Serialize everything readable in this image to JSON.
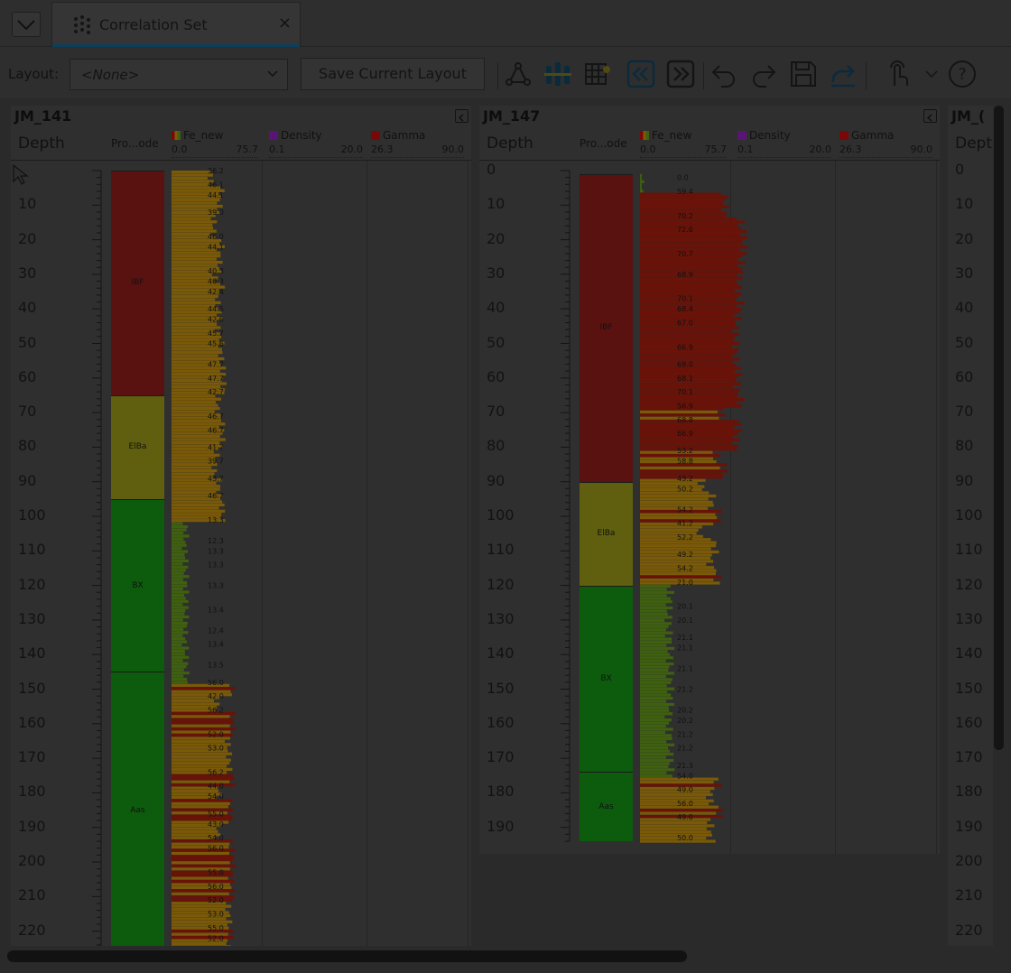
{
  "tab": {
    "title": "Correlation Set",
    "close": "×"
  },
  "toolbar": {
    "layout_label": "Layout:",
    "layout_value": "<None>",
    "save_label": "Save Current Layout"
  },
  "colors": {
    "ibf": "#5a1210",
    "elba": "#5f5f0f",
    "bx": "#0d5b0d",
    "aas": "#0d5b0d",
    "fe_low": "#3f6010",
    "fe_mid": "#7a5a08",
    "fe_high": "#6a1208",
    "density": "#5a1476",
    "gamma": "#7a0808"
  },
  "wells": [
    {
      "id": "JM_141",
      "name": "JM_141",
      "depth_header": "Depth",
      "depth_labels": [
        "10",
        "20",
        "30",
        "40",
        "50",
        "60",
        "70",
        "80",
        "90",
        "100",
        "110",
        "120",
        "130",
        "140",
        "150",
        "160",
        "170",
        "180",
        "190",
        "200",
        "210",
        "220"
      ],
      "product_header": "Pro...ode",
      "tracks": [
        {
          "name": "Fe_new",
          "min": "0.0",
          "max": "75.7"
        },
        {
          "name": "Density",
          "min": "0.1",
          "max": "20.0"
        },
        {
          "name": "Gamma",
          "min": "26.3",
          "max": "90.0"
        }
      ],
      "intervals": [
        {
          "code": "IBF",
          "from": 0,
          "to": 65
        },
        {
          "code": "ElBa",
          "from": 65,
          "to": 95
        },
        {
          "code": "BX",
          "from": 95,
          "to": 145
        },
        {
          "code": "Aas",
          "from": 145,
          "to": 225
        }
      ],
      "fe_labels": [
        {
          "depth": 0,
          "text": "36.2"
        },
        {
          "depth": 4,
          "text": "46.1"
        },
        {
          "depth": 7,
          "text": "44.1"
        },
        {
          "depth": 12,
          "text": "39.0"
        },
        {
          "depth": 19,
          "text": "46.0"
        },
        {
          "depth": 22,
          "text": "44.1"
        },
        {
          "depth": 29,
          "text": "40.3"
        },
        {
          "depth": 32,
          "text": "46.3"
        },
        {
          "depth": 35,
          "text": "42.4"
        },
        {
          "depth": 40,
          "text": "44.5"
        },
        {
          "depth": 43,
          "text": "42.6"
        },
        {
          "depth": 47,
          "text": "45.7"
        },
        {
          "depth": 50,
          "text": "45.6"
        },
        {
          "depth": 56,
          "text": "47.7"
        },
        {
          "depth": 60,
          "text": "47.7"
        },
        {
          "depth": 64,
          "text": "42.7"
        },
        {
          "depth": 71,
          "text": "46.7"
        },
        {
          "depth": 75,
          "text": "46.7"
        },
        {
          "depth": 80,
          "text": "41.7"
        },
        {
          "depth": 84,
          "text": "39.7"
        },
        {
          "depth": 89,
          "text": "43.7"
        },
        {
          "depth": 94,
          "text": "46.7"
        },
        {
          "depth": 101,
          "text": "13.3"
        },
        {
          "depth": 107,
          "text": "12.3"
        },
        {
          "depth": 110,
          "text": "13.3"
        },
        {
          "depth": 114,
          "text": "13.3"
        },
        {
          "depth": 120,
          "text": "13.3"
        },
        {
          "depth": 127,
          "text": "13.4"
        },
        {
          "depth": 133,
          "text": "12.4"
        },
        {
          "depth": 137,
          "text": "13.4"
        },
        {
          "depth": 143,
          "text": "13.5"
        },
        {
          "depth": 148,
          "text": "56.0"
        },
        {
          "depth": 152,
          "text": "42.0"
        },
        {
          "depth": 156,
          "text": "56.2"
        },
        {
          "depth": 163,
          "text": "52.0"
        },
        {
          "depth": 167,
          "text": "53.0"
        },
        {
          "depth": 174,
          "text": "56.2"
        },
        {
          "depth": 178,
          "text": "44.0"
        },
        {
          "depth": 181,
          "text": "54.0"
        },
        {
          "depth": 186,
          "text": "55.0"
        },
        {
          "depth": 189,
          "text": "43.0"
        },
        {
          "depth": 193,
          "text": "54.0"
        },
        {
          "depth": 196,
          "text": "56.0"
        },
        {
          "depth": 203,
          "text": "55.0"
        },
        {
          "depth": 207,
          "text": "56.0"
        },
        {
          "depth": 211,
          "text": "52.0"
        },
        {
          "depth": 215,
          "text": "53.0"
        },
        {
          "depth": 219,
          "text": "55.0"
        },
        {
          "depth": 222,
          "text": "52.0"
        }
      ]
    },
    {
      "id": "JM_147",
      "name": "JM_147",
      "depth_header": "Depth",
      "depth_labels": [
        "0",
        "10",
        "20",
        "30",
        "40",
        "50",
        "60",
        "70",
        "80",
        "90",
        "100",
        "110",
        "120",
        "130",
        "140",
        "150",
        "160",
        "170",
        "180",
        "190"
      ],
      "product_header": "Pro...ode",
      "tracks": [
        {
          "name": "Fe_new",
          "min": "0.0",
          "max": "75.7"
        },
        {
          "name": "Density",
          "min": "0.1",
          "max": "20.0"
        },
        {
          "name": "Gamma",
          "min": "26.3",
          "max": "90.0"
        }
      ],
      "intervals": [
        {
          "code": "IBF",
          "from": 1,
          "to": 90
        },
        {
          "code": "ElBa",
          "from": 90,
          "to": 120
        },
        {
          "code": "BX",
          "from": 120,
          "to": 174
        },
        {
          "code": "Aas",
          "from": 174,
          "to": 194
        }
      ],
      "fe_labels": [
        {
          "depth": 2,
          "text": "0.0"
        },
        {
          "depth": 6,
          "text": "59.4"
        },
        {
          "depth": 13,
          "text": "70.2"
        },
        {
          "depth": 17,
          "text": "72.6"
        },
        {
          "depth": 24,
          "text": "70.7"
        },
        {
          "depth": 30,
          "text": "68.9"
        },
        {
          "depth": 37,
          "text": "70.1"
        },
        {
          "depth": 40,
          "text": "68.4"
        },
        {
          "depth": 44,
          "text": "67.0"
        },
        {
          "depth": 51,
          "text": "66.9"
        },
        {
          "depth": 56,
          "text": "69.0"
        },
        {
          "depth": 60,
          "text": "68.1"
        },
        {
          "depth": 64,
          "text": "70.1"
        },
        {
          "depth": 68,
          "text": "56.9"
        },
        {
          "depth": 72,
          "text": "68.8"
        },
        {
          "depth": 76,
          "text": "66.9"
        },
        {
          "depth": 81,
          "text": "53.2"
        },
        {
          "depth": 84,
          "text": "58.8"
        },
        {
          "depth": 89,
          "text": "43.2"
        },
        {
          "depth": 92,
          "text": "50.2"
        },
        {
          "depth": 98,
          "text": "54.2"
        },
        {
          "depth": 102,
          "text": "41.2"
        },
        {
          "depth": 106,
          "text": "52.2"
        },
        {
          "depth": 111,
          "text": "49.2"
        },
        {
          "depth": 115,
          "text": "54.2"
        },
        {
          "depth": 119,
          "text": "21.0"
        },
        {
          "depth": 126,
          "text": "20.1"
        },
        {
          "depth": 130,
          "text": "20.1"
        },
        {
          "depth": 135,
          "text": "21.1"
        },
        {
          "depth": 138,
          "text": "21.1"
        },
        {
          "depth": 144,
          "text": "21.1"
        },
        {
          "depth": 150,
          "text": "21.2"
        },
        {
          "depth": 156,
          "text": "20.2"
        },
        {
          "depth": 159,
          "text": "20.2"
        },
        {
          "depth": 163,
          "text": "21.2"
        },
        {
          "depth": 167,
          "text": "21.2"
        },
        {
          "depth": 172,
          "text": "21.3"
        },
        {
          "depth": 175,
          "text": "54.0"
        },
        {
          "depth": 179,
          "text": "49.0"
        },
        {
          "depth": 183,
          "text": "56.0"
        },
        {
          "depth": 187,
          "text": "49.0"
        },
        {
          "depth": 193,
          "text": "50.0"
        }
      ]
    },
    {
      "id": "JM_partial",
      "name": "JM_(",
      "depth_header": "Dept",
      "depth_labels": [
        "0",
        "10",
        "20",
        "30",
        "40",
        "50",
        "60",
        "70",
        "80",
        "90",
        "100",
        "110",
        "120",
        "130",
        "140",
        "150",
        "160",
        "170",
        "180",
        "190",
        "200",
        "210",
        "220"
      ]
    }
  ]
}
